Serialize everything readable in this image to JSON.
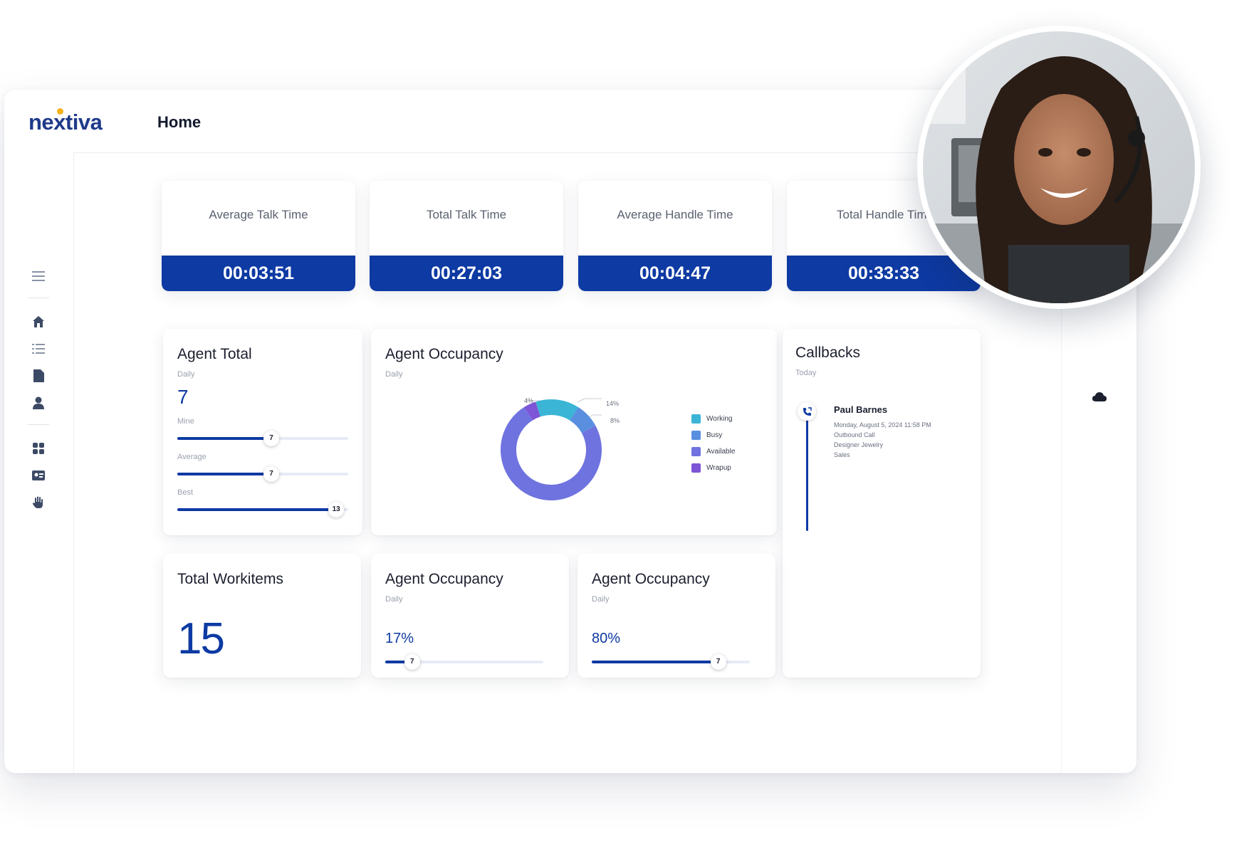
{
  "app": {
    "logo": "nextiva",
    "page_title": "Home"
  },
  "sidebar": {
    "icons": [
      "menu-icon",
      "home-icon",
      "list-icon",
      "document-icon",
      "user-icon",
      "apps-grid-icon",
      "contact-card-icon",
      "hand-icon"
    ]
  },
  "metrics": [
    {
      "label": "Average Talk Time",
      "value": "00:03:51"
    },
    {
      "label": "Total Talk Time",
      "value": "00:27:03"
    },
    {
      "label": "Average Handle Time",
      "value": "00:04:47"
    },
    {
      "label": "Total Handle Tim",
      "value": "00:33:33"
    }
  ],
  "agent_total": {
    "title": "Agent Total",
    "period": "Daily",
    "value": "7",
    "bars": [
      {
        "label": "Mine",
        "value": "7",
        "fraction": 0.55
      },
      {
        "label": "Average",
        "value": "7",
        "fraction": 0.55
      },
      {
        "label": "Best",
        "value": "13",
        "fraction": 0.93
      }
    ]
  },
  "occupancy_chart": {
    "title": "Agent Occupancy",
    "period": "Daily",
    "labels": {
      "top_left": "4%",
      "top_right": "14%",
      "right": "8%"
    },
    "legend": [
      "Working",
      "Busy",
      "Available",
      "Wrapup"
    ]
  },
  "chart_data": {
    "type": "pie",
    "donut": true,
    "categories": [
      "Working",
      "Busy",
      "Available",
      "Wrapup"
    ],
    "values": [
      14,
      8,
      74,
      4
    ],
    "colors": [
      "#3ab5d6",
      "#5a8fe0",
      "#6f73df",
      "#7d55d6"
    ]
  },
  "callbacks": {
    "title": "Callbacks",
    "period": "Today",
    "item": {
      "name": "Paul Barnes",
      "datetime": "Monday, August 5, 2024 11:58 PM",
      "type": "Outbound Call",
      "company": "Designer Jewelry",
      "department": "Sales"
    }
  },
  "workitems": {
    "title": "Total Workitems",
    "value": "15"
  },
  "occupancy_small": [
    {
      "title": "Agent Occupancy",
      "period": "Daily",
      "percent_label": "17%",
      "knob": "7",
      "fraction": 0.17
    },
    {
      "title": "Agent Occupancy",
      "period": "Daily",
      "percent_label": "80%",
      "knob": "7",
      "fraction": 0.8
    }
  ],
  "colors": {
    "brand_blue": "#0d3aa3",
    "logo_blue": "#1e3a8a",
    "logo_dot": "#f5b21b",
    "track": "#e6ebf7"
  }
}
